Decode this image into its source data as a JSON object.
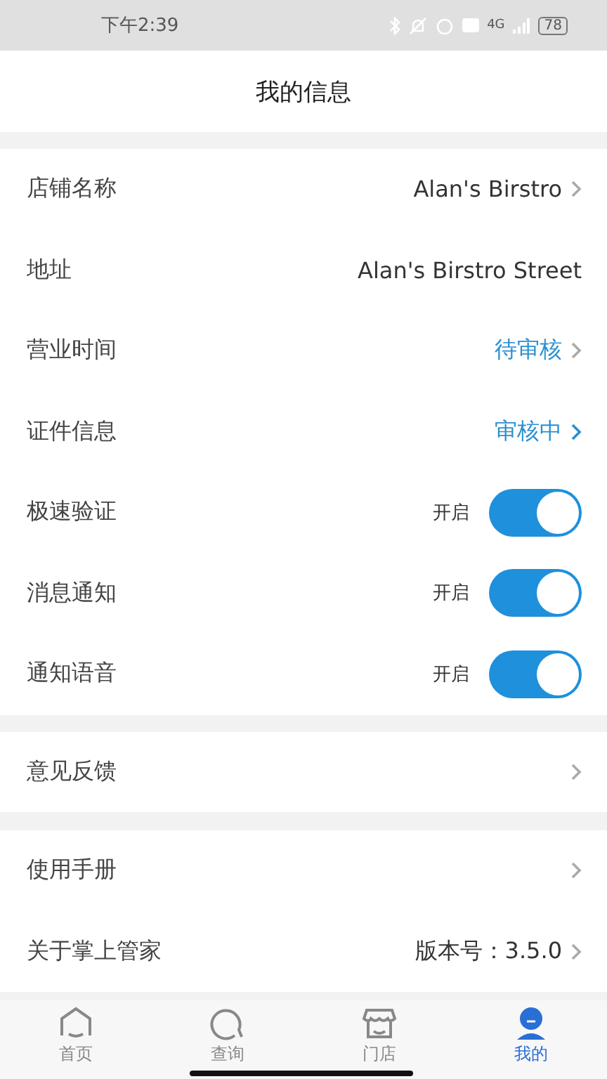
{
  "status_bar": {
    "time": "下午2:39",
    "network": "4G",
    "battery": "78"
  },
  "header": {
    "title": "我的信息"
  },
  "sections": [
    {
      "rows": [
        {
          "kind": "link",
          "label": "店铺名称",
          "value": "Alan's Birstro"
        },
        {
          "kind": "text",
          "label": "地址",
          "value": "Alan's Birstro Street"
        },
        {
          "kind": "status",
          "label": "营业时间",
          "value": "待审核",
          "accent_chevron": false
        },
        {
          "kind": "status",
          "label": "证件信息",
          "value": "审核中",
          "accent_chevron": true
        },
        {
          "kind": "toggle",
          "label": "极速验证",
          "value": "开启",
          "on": true
        },
        {
          "kind": "toggle",
          "label": "消息通知",
          "value": "开启",
          "on": true
        },
        {
          "kind": "toggle",
          "label": "通知语音",
          "value": "开启",
          "on": true
        }
      ]
    },
    {
      "rows": [
        {
          "kind": "link",
          "label": "意见反馈"
        }
      ]
    },
    {
      "rows": [
        {
          "kind": "link",
          "label": "使用手册"
        },
        {
          "kind": "link",
          "label": "关于掌上管家",
          "value": "版本号：3.5.0"
        }
      ]
    }
  ],
  "tab_bar": [
    {
      "label": "首页",
      "selected": false
    },
    {
      "label": "查询",
      "selected": false
    },
    {
      "label": "门店",
      "selected": false
    },
    {
      "label": "我的",
      "selected": true
    }
  ]
}
